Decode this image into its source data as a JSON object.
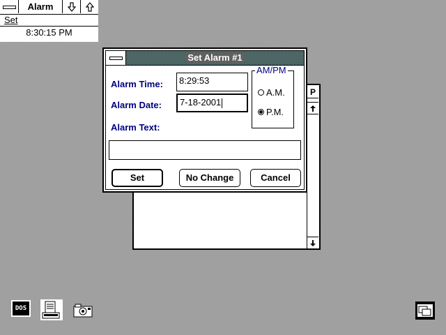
{
  "alarm_app": {
    "title": "Alarm",
    "menu": {
      "set_label": "Set"
    },
    "clock": "8:30:15 PM"
  },
  "dialog": {
    "title": "Set Alarm #1",
    "alarm_time_label": "Alarm Time:",
    "alarm_time_value": "8:29:53",
    "alarm_date_label": "Alarm Date:",
    "alarm_date_value": "7-18-2001",
    "alarm_text_label": "Alarm Text:",
    "alarm_text_value": "",
    "ampm_group": {
      "title": "AM/PM",
      "am_label": "A.M.",
      "pm_label": "P.M.",
      "selected": "P.M."
    },
    "buttons": {
      "set": "Set",
      "no_change": "No Change",
      "cancel": "Cancel"
    }
  },
  "background_window": {
    "tab_letter": "P"
  },
  "desktop_icons": [
    {
      "name": "dos-icon",
      "label": "DOS"
    },
    {
      "name": "write-icon"
    },
    {
      "name": "camera-icon"
    },
    {
      "name": "task-switch-icon"
    }
  ]
}
